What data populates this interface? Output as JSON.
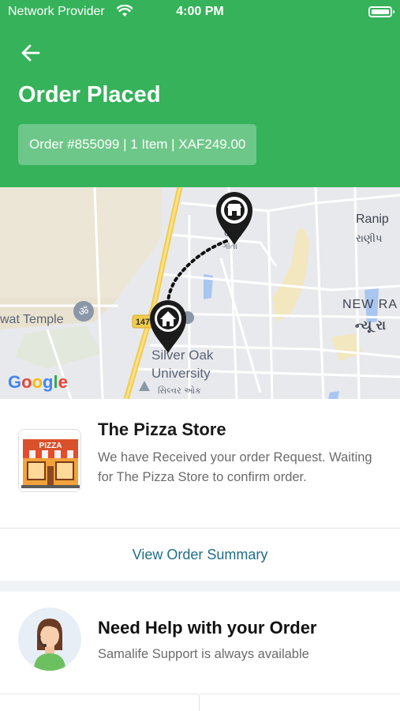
{
  "status_bar": {
    "carrier": "Network Provider",
    "time": "4:00 PM",
    "icons": [
      "wifi-icon",
      "battery-icon"
    ]
  },
  "header": {
    "back_icon": "arrow-left-icon",
    "title": "Order Placed",
    "order_summary": "Order #855099 | 1 Item | XAF249.00",
    "background_color": "#35b25a"
  },
  "map": {
    "provider_logo": "Google",
    "labels": {
      "silver_oak": "Silver Oak",
      "university": "University",
      "silver_oak_gujarati": "સિલ્વર ઓક",
      "ranip": "Ranip",
      "ranip_gujarati": "રાણીપ",
      "new_ra": "NEW RA",
      "new_ra_gujarati": "ન્યૂ રા",
      "wat_temple": "wat Temple",
      "gota_partial": "OTA",
      "gota_gujarati": "ગોતા",
      "highway": "147"
    },
    "markers": [
      "store-marker-icon",
      "home-marker-icon"
    ]
  },
  "store": {
    "name": "The Pizza Store",
    "status": "We have Received your order Request. Waiting for The Pizza Store to confirm order.",
    "logo_text": "PIZZA"
  },
  "actions": {
    "view_summary": "View Order Summary",
    "link_color": "#1f6d8a"
  },
  "help": {
    "title": "Need Help with your Order",
    "subtitle": "Samalife Support is always available"
  }
}
